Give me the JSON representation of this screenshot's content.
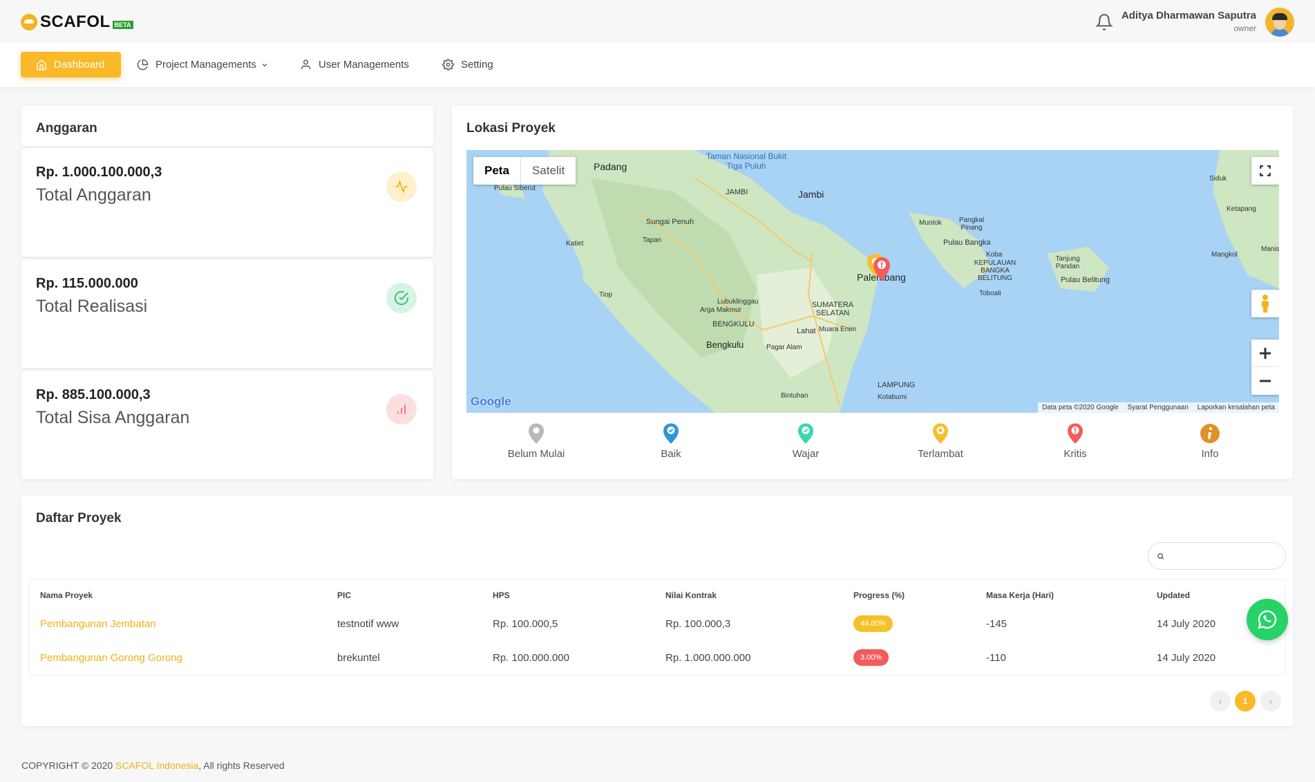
{
  "app": {
    "logo_text": "SCAFOL",
    "logo_badge": "BETA",
    "user_name": "Aditya Dharmawan Saputra",
    "user_role": "owner"
  },
  "nav": {
    "dashboard": "Dashboard",
    "project_managements": "Project Managements",
    "user_managements": "User Managements",
    "setting": "Setting"
  },
  "budget": {
    "title": "Anggaran",
    "items": [
      {
        "value": "Rp. 1.000.100.000,3",
        "label": "Total Anggaran",
        "icon": "activity-icon",
        "color": "#f0b018"
      },
      {
        "value": "Rp. 115.000.000",
        "label": "Total Realisasi",
        "icon": "check-circle-icon",
        "color": "#2fbf71"
      },
      {
        "value": "Rp. 885.100.000,3",
        "label": "Total Sisa Anggaran",
        "icon": "bar-chart-icon",
        "color": "#f06565"
      }
    ]
  },
  "map": {
    "title": "Lokasi Proyek",
    "map_type_options": [
      "Peta",
      "Satelit"
    ],
    "selected_map_type": "Peta",
    "place_labels": [
      "Padang",
      "Taman Nasional Bukit Tiga Puluh",
      "JAMBI",
      "Jambi",
      "Pulau Siberut",
      "Sungai Penuh",
      "Tapan",
      "Katiet",
      "Tiop",
      "Muntok",
      "Pangkal Pinang",
      "Pulau Bangka",
      "KEPULAUAN BANGKA BELITUNG",
      "Koba",
      "Toboali",
      "Tanjung Pandan",
      "Pulau Belitung",
      "Palembang",
      "SUMATERA SELATAN",
      "Lubuklinggau",
      "Arga Makmur",
      "BENGKULU",
      "Bengkulu",
      "Lahat",
      "Muara Enim",
      "Pagar Alam",
      "Bintuhan",
      "Kotabumi",
      "LAMPUNG",
      "Siduk",
      "Ketapang",
      "Mangkol",
      "Manis"
    ],
    "attribution": [
      "Data peta ©2020 Google",
      "Syarat Penggunaan",
      "Laporkan kesalahan peta"
    ],
    "google_logo": "Google",
    "legend": [
      {
        "label": "Belum Mulai",
        "color": "#b9b9b9"
      },
      {
        "label": "Baik",
        "color": "#2f96d8"
      },
      {
        "label": "Wajar",
        "color": "#3bd6b0"
      },
      {
        "label": "Terlambat",
        "color": "#f5c02a"
      },
      {
        "label": "Kritis",
        "color": "#f25c5c"
      },
      {
        "label": "Info",
        "color": "#e0912a"
      }
    ]
  },
  "projects": {
    "title": "Daftar Proyek",
    "search_placeholder": "",
    "columns": [
      "Nama Proyek",
      "PIC",
      "HPS",
      "Nilai Kontrak",
      "Progress (%)",
      "Masa Kerja (Hari)",
      "Updated"
    ],
    "rows": [
      {
        "name": "Pembangunan Jembatan",
        "pic": "testnotif www",
        "hps": "Rp. 100.000,5",
        "contract": "Rp. 100.000,3",
        "progress": "44.00%",
        "progress_color": "#f5c02a",
        "duration": "-145",
        "updated": "14 July 2020"
      },
      {
        "name": "Pembangunan Gorong Gorong",
        "pic": "brekuntel",
        "hps": "Rp. 100.000.000",
        "contract": "Rp. 1.000.000.000",
        "progress": "3.00%",
        "progress_color": "#f25c5c",
        "duration": "-110",
        "updated": "14 July 2020"
      }
    ],
    "pager": {
      "prev": "‹",
      "current": "1",
      "next": "›"
    }
  },
  "footer": {
    "prefix": "COPYRIGHT © 2020 ",
    "brand": "SCAFOL Indonesia",
    "suffix": ", All rights Reserved"
  }
}
